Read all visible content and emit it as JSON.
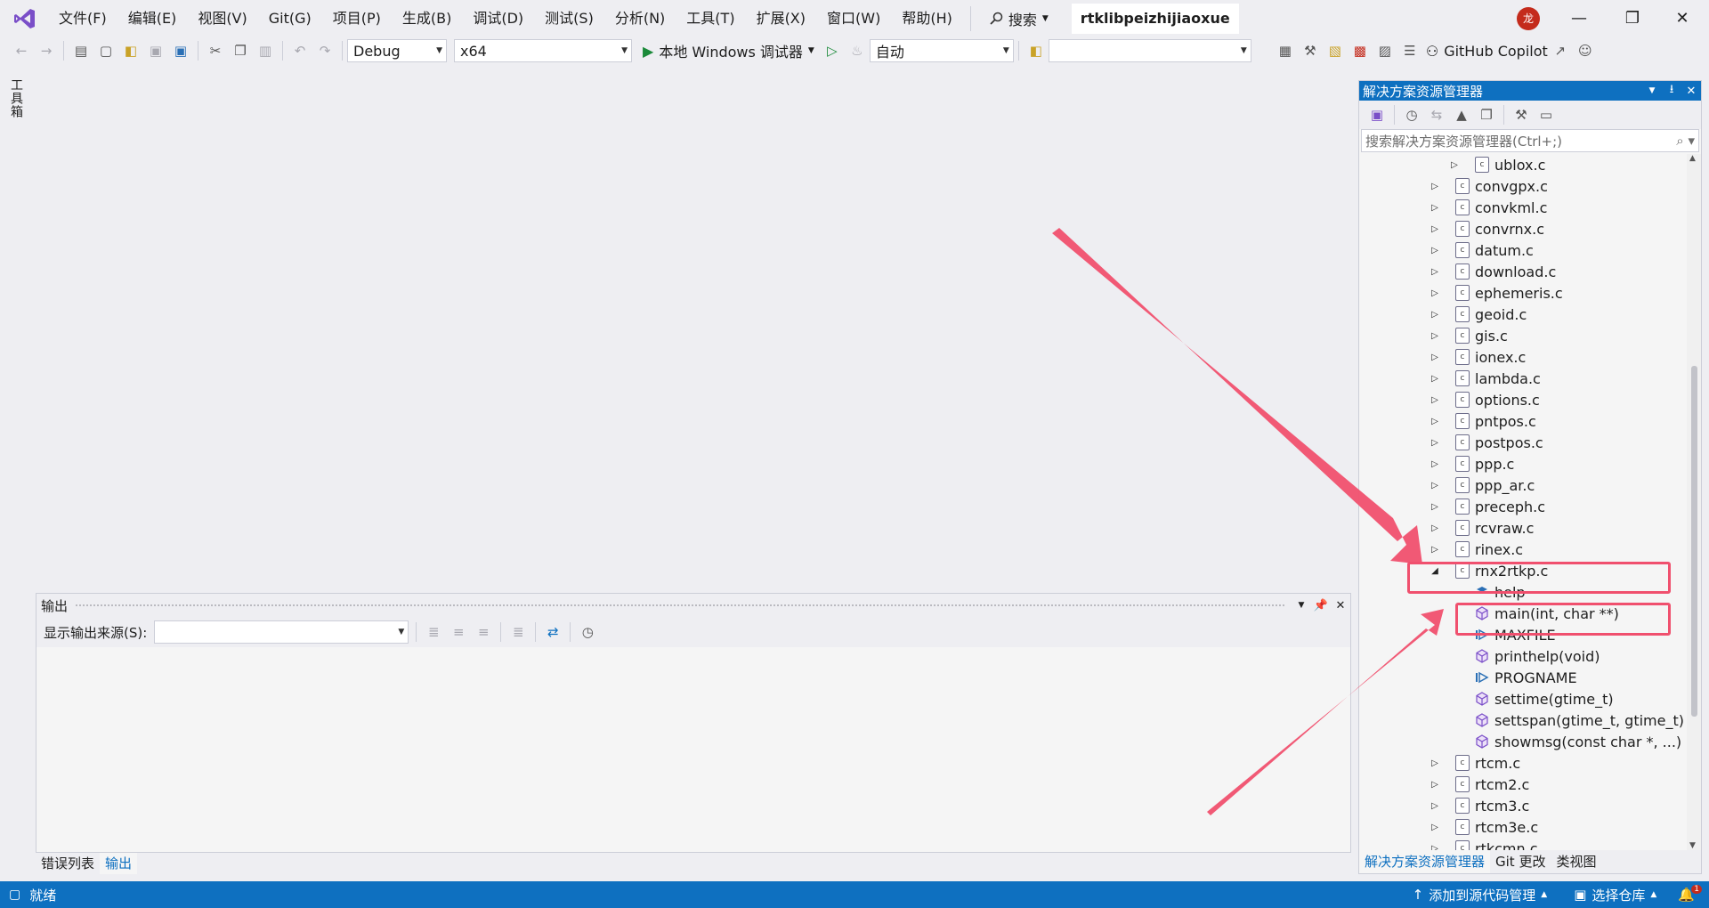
{
  "menu": [
    "文件(F)",
    "编辑(E)",
    "视图(V)",
    "Git(G)",
    "项目(P)",
    "生成(B)",
    "调试(D)",
    "测试(S)",
    "分析(N)",
    "工具(T)",
    "扩展(X)",
    "窗口(W)",
    "帮助(H)"
  ],
  "search_label": "搜索",
  "window_title": "rtklibpeizhijiaoxue",
  "user_initial": "龙",
  "toolbar": {
    "config": "Debug",
    "platform": "x64",
    "run_label": "本地 Windows 调试器",
    "auto": "自动",
    "copilot": "GitHub Copilot"
  },
  "left_strip_label": "工具箱",
  "output": {
    "title": "输出",
    "source_label": "显示输出来源(S):",
    "source_value": ""
  },
  "bottom_tabs": [
    "错误列表",
    "输出"
  ],
  "solution_explorer": {
    "title": "解决方案资源管理器",
    "search_placeholder": "搜索解决方案资源管理器(Ctrl+;)",
    "tree": [
      {
        "label": "ublox.c",
        "level": 2,
        "kind": "file",
        "expanded": false
      },
      {
        "label": "convgpx.c",
        "level": 1,
        "kind": "file",
        "expanded": false
      },
      {
        "label": "convkml.c",
        "level": 1,
        "kind": "file",
        "expanded": false
      },
      {
        "label": "convrnx.c",
        "level": 1,
        "kind": "file",
        "expanded": false
      },
      {
        "label": "datum.c",
        "level": 1,
        "kind": "file",
        "expanded": false
      },
      {
        "label": "download.c",
        "level": 1,
        "kind": "file",
        "expanded": false
      },
      {
        "label": "ephemeris.c",
        "level": 1,
        "kind": "file",
        "expanded": false
      },
      {
        "label": "geoid.c",
        "level": 1,
        "kind": "file",
        "expanded": false
      },
      {
        "label": "gis.c",
        "level": 1,
        "kind": "file",
        "expanded": false
      },
      {
        "label": "ionex.c",
        "level": 1,
        "kind": "file",
        "expanded": false
      },
      {
        "label": "lambda.c",
        "level": 1,
        "kind": "file",
        "expanded": false
      },
      {
        "label": "options.c",
        "level": 1,
        "kind": "file",
        "expanded": false
      },
      {
        "label": "pntpos.c",
        "level": 1,
        "kind": "file",
        "expanded": false
      },
      {
        "label": "postpos.c",
        "level": 1,
        "kind": "file",
        "expanded": false
      },
      {
        "label": "ppp.c",
        "level": 1,
        "kind": "file",
        "expanded": false
      },
      {
        "label": "ppp_ar.c",
        "level": 1,
        "kind": "file",
        "expanded": false
      },
      {
        "label": "preceph.c",
        "level": 1,
        "kind": "file",
        "expanded": false
      },
      {
        "label": "rcvraw.c",
        "level": 1,
        "kind": "file",
        "expanded": false
      },
      {
        "label": "rinex.c",
        "level": 1,
        "kind": "file",
        "expanded": false
      },
      {
        "label": "rnx2rtkp.c",
        "level": 1,
        "kind": "file",
        "expanded": true
      },
      {
        "label": "help",
        "level": 2,
        "kind": "var"
      },
      {
        "label": "main(int, char **)",
        "level": 2,
        "kind": "func"
      },
      {
        "label": "MAXFILE",
        "level": 2,
        "kind": "macro"
      },
      {
        "label": "printhelp(void)",
        "level": 2,
        "kind": "func"
      },
      {
        "label": "PROGNAME",
        "level": 2,
        "kind": "macro"
      },
      {
        "label": "settime(gtime_t)",
        "level": 2,
        "kind": "func"
      },
      {
        "label": "settspan(gtime_t, gtime_t)",
        "level": 2,
        "kind": "func"
      },
      {
        "label": "showmsg(const char *, ...)",
        "level": 2,
        "kind": "func"
      },
      {
        "label": "rtcm.c",
        "level": 1,
        "kind": "file",
        "expanded": false
      },
      {
        "label": "rtcm2.c",
        "level": 1,
        "kind": "file",
        "expanded": false
      },
      {
        "label": "rtcm3.c",
        "level": 1,
        "kind": "file",
        "expanded": false
      },
      {
        "label": "rtcm3e.c",
        "level": 1,
        "kind": "file",
        "expanded": false
      },
      {
        "label": "rtkcmn.c",
        "level": 1,
        "kind": "file",
        "expanded": false
      }
    ],
    "tabs": [
      "解决方案资源管理器",
      "Git 更改",
      "类视图"
    ]
  },
  "status": {
    "ready": "就绪",
    "add_source": "添加到源代码管理",
    "select_repo": "选择仓库",
    "notifications": "1"
  },
  "colors": {
    "accent": "#0e70c0",
    "annotation": "#f0506e"
  }
}
